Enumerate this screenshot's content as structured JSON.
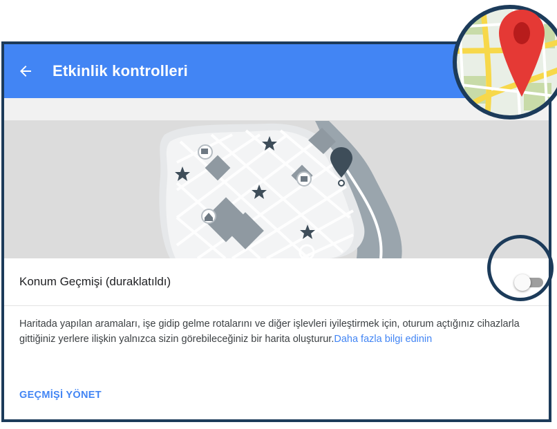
{
  "header": {
    "title": "Etkinlik kontrolleri"
  },
  "icons": {
    "back": "arrow-left-icon",
    "map_badge": "map-pin-icon",
    "illustration": "map-illustration"
  },
  "location_history": {
    "label": "Konum Geçmişi (duraklatıldı)",
    "enabled": false
  },
  "description": {
    "text": "Haritada yapılan aramaları, işe gidip gelme rotalarını ve diğer işlevleri iyileştirmek için, oturum açtığınız cihazlarla gittiğiniz yerlere ilişkin yalnızca sizin görebileceğiniz bir harita oluşturur.",
    "link": "Daha fazla bilgi edinin"
  },
  "actions": {
    "manage_history": "GEÇMİŞİ YÖNET"
  },
  "colors": {
    "header": "#4285f4",
    "link": "#4285f4",
    "frame": "#1c3b5a",
    "pin_red": "#e53935"
  }
}
